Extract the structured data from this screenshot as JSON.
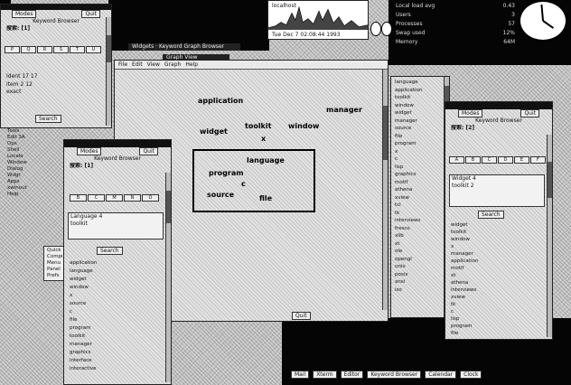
{
  "perf_meter": {
    "host": "localhost",
    "date_time": "Tue Dec  7 02:08:44 1993"
  },
  "info_window": {
    "rows": [
      [
        "Local load avg",
        "0.43"
      ],
      [
        "Users",
        "3"
      ],
      [
        "Processes",
        "57"
      ],
      [
        "Swap used",
        "12%"
      ],
      [
        "Memory",
        "64M"
      ]
    ]
  },
  "top_left_window": {
    "header_left": "Modes",
    "header_right": "Quit",
    "subtitle": "Keyword Browser",
    "field_label": "搜索: [1]",
    "cols": [
      "P",
      "Q",
      "R",
      "S",
      "T",
      "U"
    ],
    "items": [
      "Ident 17 17",
      "item 2 12",
      "exact"
    ],
    "button": "Search"
  },
  "left_column_labels": [
    "Tools",
    "Edit 3A",
    "Ops",
    "Shell",
    "Locale",
    "Window",
    "Dialog",
    "Wdgt",
    "Apps",
    "xwinout",
    "Help"
  ],
  "left_items_bottom": [
    "Quick",
    "Compile",
    "Menu",
    "Panel",
    "Prefs"
  ],
  "center_window": {
    "title": "Widgets · Keyword Graph Browser",
    "subtitle": "Graph View",
    "menus": [
      "File",
      "Edit",
      "View",
      "Graph",
      "Help"
    ],
    "words": {
      "application": "application",
      "manager": "manager",
      "widget": "widget",
      "toolkit": "toolkit",
      "window": "window",
      "x": "x",
      "language": "language",
      "program": "program",
      "c": "c",
      "source": "source",
      "file": "file"
    },
    "status": "Quit"
  },
  "right_sidebar_list": [
    "language",
    "application",
    "toolkit",
    "window",
    "widget",
    "manager",
    "source",
    "file",
    "program",
    "x",
    "c",
    "lisp",
    "graphics",
    "motif",
    "athena",
    "xview",
    "tcl",
    "tk",
    "interviews",
    "fresco",
    "xlib",
    "xt",
    "ole",
    "opengl",
    "unix",
    "posix",
    "ansi",
    "iso"
  ],
  "mid_left_window": {
    "header_left": "Modes",
    "header_right": "Quit",
    "subtitle": "Keyword Browser",
    "field_label": "搜索: [1]",
    "cols": [
      "B",
      "C",
      "M",
      "N",
      "O"
    ],
    "entry": "Language 4",
    "list_top": [
      "toolkit"
    ],
    "button": "Search",
    "list": [
      "application",
      "language",
      "widget",
      "window",
      "x",
      "source",
      "c",
      "file",
      "program",
      "toolkit",
      "manager",
      "graphics",
      "interface",
      "interactive"
    ]
  },
  "right_window": {
    "header_left": "Modes",
    "header_right": "Quit",
    "subtitle": "Keyword Browser",
    "field_label": "搜索: [2]",
    "cols": [
      "A",
      "B",
      "C",
      "D",
      "E",
      "F"
    ],
    "entry": "Widget 4",
    "entry2": "toolkit 2",
    "button": "Search",
    "list": [
      "widget",
      "toolkit",
      "window",
      "x",
      "manager",
      "application",
      "motif",
      "xt",
      "athena",
      "interviews",
      "xview",
      "tk",
      "c",
      "lisp",
      "program",
      "file"
    ]
  },
  "taskbar": {
    "items": [
      "Mail",
      "Xterm",
      "Editor",
      "Keyword Browser",
      "Calendar",
      "Clock"
    ]
  },
  "colors": {
    "dark": "#050505",
    "window_bg": "#e2e2e2",
    "text": "#111111"
  }
}
